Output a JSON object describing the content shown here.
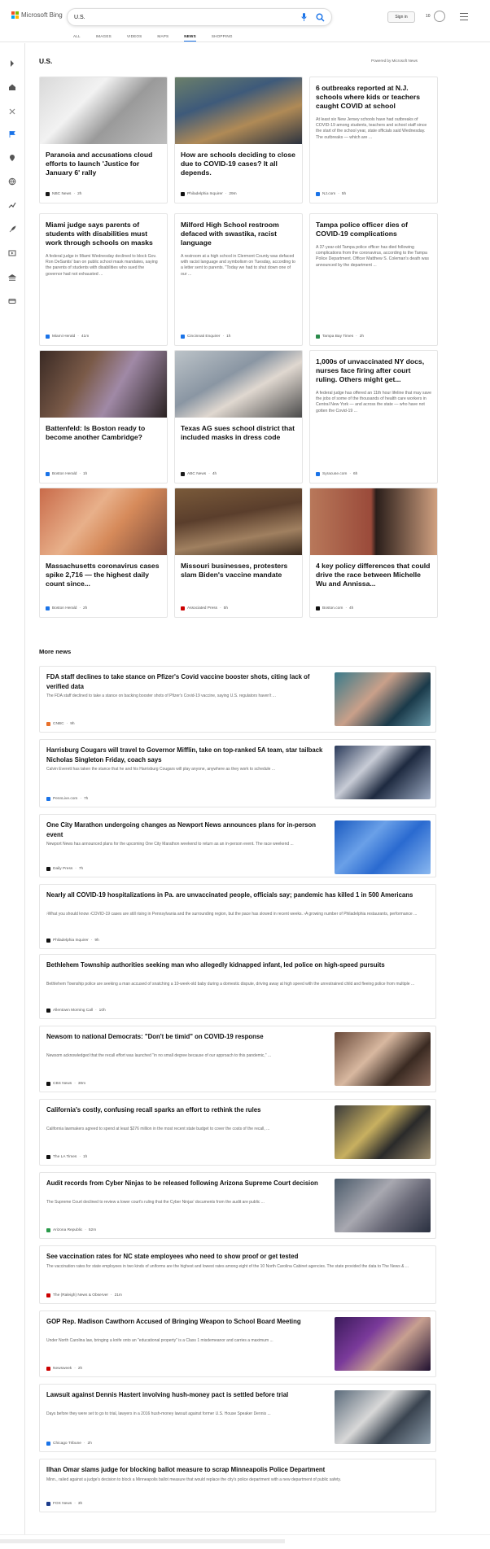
{
  "header": {
    "brand": "Microsoft Bing",
    "search_value": "U.S.",
    "sign_in": "Sign in",
    "points": "10",
    "tabs": [
      "ALL",
      "IMAGES",
      "VIDEOS",
      "MAPS",
      "NEWS",
      "SHOPPING"
    ],
    "active_tab": "NEWS"
  },
  "sidebar_icons": [
    "chevron-right-icon",
    "home-icon",
    "tools-icon",
    "flag-icon",
    "location-icon",
    "globe-icon",
    "trending-icon",
    "rocket-icon",
    "film-icon",
    "bank-icon",
    "card-icon"
  ],
  "section": {
    "title": "U.S.",
    "powered_by": "Powered by Microsoft News"
  },
  "cards": [
    {
      "title": "Paranoia and accusations cloud efforts to launch 'Justice for January 6' rally",
      "desc": "",
      "source": "NBC News",
      "time": "2h",
      "has_image": true
    },
    {
      "title": "How are schools deciding to close due to COVID-19 cases? It all depends.",
      "desc": "",
      "source": "Philadelphia Inquirer",
      "time": "29m",
      "has_image": true
    },
    {
      "title": "6 outbreaks reported at N.J. schools where kids or teachers caught COVID at school",
      "desc": "At least six New Jersey schools have had outbreaks of COVID-19 among students, teachers and school staff since the start of the school year, state officials said Wednesday. The outbreaks — which are ...",
      "source": "NJ.com",
      "time": "5h",
      "has_image": false
    },
    {
      "title": "Miami judge says parents of students with disabilities must work through schools on masks",
      "desc": "A federal judge in Miami Wednesday declined to block Gov. Ron DeSantis' ban on public school mask mandates, saying the parents of students with disabilities who sued the governor had not exhausted ...",
      "source": "Miami Herald",
      "time": "41m",
      "has_image": false
    },
    {
      "title": "Milford High School restroom defaced with swastika, racist language",
      "desc": "A restroom at a high school in Clermont County was defaced with racist language and symbolism on Tuesday, according to a letter sent to parents. \"Today we had to shut down one of our ...",
      "source": "Cincinnati Enquirer",
      "time": "1h",
      "has_image": false
    },
    {
      "title": "Tampa police officer dies of COVID-19 complications",
      "desc": "A 37-year-old Tampa police officer has died following complications from the coronavirus, according to the Tampa Police Department. Officer Matthew S. Coleman's death was announced by the department ...",
      "source": "Tampa Bay Times",
      "time": "2h",
      "has_image": false
    },
    {
      "title": "Battenfeld: Is Boston ready to become another Cambridge?",
      "desc": "",
      "source": "Boston Herald",
      "time": "1h",
      "has_image": true
    },
    {
      "title": "Texas AG sues school district that included masks in dress code",
      "desc": "",
      "source": "ABC News",
      "time": "4h",
      "has_image": true
    },
    {
      "title": "1,000s of unvaccinated NY docs, nurses face firing after court ruling. Others might get...",
      "desc": "A federal judge has offered an 11th hour lifeline that may save the jobs of some of the thousands of health care workers in Central New York — and across the state — who have not gotten the Covid-19 ...",
      "source": "Syracuse.com",
      "time": "6h",
      "has_image": false
    },
    {
      "title": "Massachusetts coronavirus cases spike 2,716 — the highest daily count since...",
      "desc": "",
      "source": "Boston Herald",
      "time": "2h",
      "has_image": true
    },
    {
      "title": "Missouri businesses, protesters slam Biden's vaccine mandate",
      "desc": "",
      "source": "Associated Press",
      "time": "5h",
      "has_image": true
    },
    {
      "title": "4 key policy differences that could drive the race between Michelle Wu and Annissa...",
      "desc": "",
      "source": "Boston.com",
      "time": "4h",
      "has_image": true
    }
  ],
  "more_news": {
    "title": "More news",
    "items": [
      {
        "title": "FDA staff declines to take stance on Pfizer's Covid vaccine booster shots, citing lack of verified data",
        "desc": "The FDA staff declined to take a stance on backing booster shots of Pfizer's Covid-19 vaccine, saying U.S. regulators haven't ...",
        "source": "CNBC",
        "time": "9h",
        "has_image": true
      },
      {
        "title": "Harrisburg Cougars will travel to Governor Mifflin, take on top-ranked 5A team, star tailback Nicholas Singleton Friday, coach says",
        "desc": "Calvin Everett has taken the stance that he and his Harrisburg Cougars will play anyone, anywhere as they work to schedule ...",
        "source": "PennLive.com",
        "time": "7h",
        "has_image": true
      },
      {
        "title": "One City Marathon undergoing changes as Newport News announces plans for in-person event",
        "desc": "Newport News has announced plans for the upcoming One City Marathon weekend to return as an in-person event. The race weekend ...",
        "source": "Daily Press",
        "time": "7h",
        "has_image": true
      },
      {
        "title": "Nearly all COVID-19 hospitalizations in Pa. are unvaccinated people, officials say; pandemic has killed 1 in 500 Americans",
        "desc": "›What you should know ›COVID-19 cases are still rising in Pennsylvania and the surrounding region, but the pace has slowed in recent weeks. ›A growing number of Philadelphia restaurants, performance ...",
        "source": "Philadelphia Inquirer",
        "time": "9h",
        "has_image": false
      },
      {
        "title": "Bethlehem Township authorities seeking man who allegedly kidnapped infant, led police on high-speed pursuits",
        "desc": "Bethlehem Township police are seeking a man accused of snatching a 10-week-old baby during a domestic dispute, driving away at high speed with the unrestrained child and fleeing police from multiple ...",
        "source": "Allentown Morning Call",
        "time": "10h",
        "has_image": false
      },
      {
        "title": "Newsom to national Democrats: \"Don't be timid\" on COVID-19 response",
        "desc": "Newsom acknowledged that the recall effort was launched \"in no small degree because of our approach to this pandemic,\" ...",
        "source": "CBS News",
        "time": "30m",
        "has_image": true
      },
      {
        "title": "California's costly, confusing recall sparks an effort to rethink the rules",
        "desc": "California lawmakers agreed to spend at least $276 million in the most recent state budget to cover the costs of the recall, ...",
        "source": "The LA Times",
        "time": "1h",
        "has_image": true
      },
      {
        "title": "Audit records from Cyber Ninjas to be released following Arizona Supreme Court decision",
        "desc": "The Supreme Court declined to review a lower court's ruling that the Cyber Ninjas' documents from the audit are public ...",
        "source": "Arizona Republic",
        "time": "52m",
        "has_image": true
      },
      {
        "title": "See vaccination rates for NC state employees who need to show proof or get tested",
        "desc": "The vaccination rates for state employees in two kinds of uniforms are the highest and lowest rates among eight of the 10 North Carolina Cabinet agencies. The state provided the data to The News & ...",
        "source": "The (Raleigh) News & Observer",
        "time": "21m",
        "has_image": false
      },
      {
        "title": "GOP Rep. Madison Cawthorn Accused of Bringing Weapon to School Board Meeting",
        "desc": "Under North Carolina law, bringing a knife onto an \"educational property\" is a Class 1 misdemeanor and carries a maximum ...",
        "source": "Newsweek",
        "time": "2h",
        "has_image": true
      },
      {
        "title": "Lawsuit against Dennis Hastert involving hush-money pact is settled before trial",
        "desc": "Days before they were set to go to trial, lawyers in a 2016 hush-money lawsuit against former U.S. House Speaker Dennis ...",
        "source": "Chicago Tribune",
        "time": "2h",
        "has_image": true
      },
      {
        "title": "Ilhan Omar slams judge for blocking ballot measure to scrap Minneapolis Police Department",
        "desc": "Minn., railed against a judge's decision to block a Minneapolis ballot measure that would replace the city's police department with a new department of public safety.",
        "source": "FOX News",
        "time": "3h",
        "has_image": false
      }
    ]
  },
  "colors": {
    "accent": "#1a73e8",
    "border": "#e5e5e5",
    "text": "#111111",
    "muted": "#666666"
  }
}
